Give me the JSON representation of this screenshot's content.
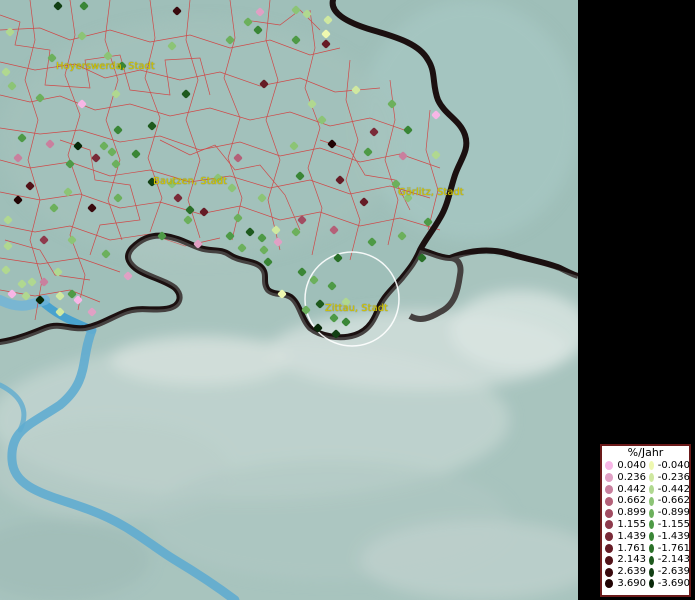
{
  "map": {
    "towns": [
      {
        "name": "Hoyerswerda, Stadt"
      },
      {
        "name": "Bautzen, Stadt"
      },
      {
        "name": "Görlitz, Stadt"
      },
      {
        "name": "Zittau, Stadt"
      }
    ],
    "colors": {
      "terrain": "#9fbfb9",
      "border": "#1b1010",
      "river": "#3f9fd0",
      "district_lines": "#d63535",
      "selection_circle": "#ffffff",
      "town_label": "#d8c800"
    }
  },
  "legend": {
    "title": "%/Jahr",
    "positive": [
      {
        "value": "0.040",
        "color": "#f7b6e6"
      },
      {
        "value": "0.236",
        "color": "#e0a0c4"
      },
      {
        "value": "0.442",
        "color": "#c9809e"
      },
      {
        "value": "0.662",
        "color": "#b46078"
      },
      {
        "value": "0.899",
        "color": "#a24c62"
      },
      {
        "value": "1.155",
        "color": "#8e3a4c"
      },
      {
        "value": "1.439",
        "color": "#7a2a38"
      },
      {
        "value": "1.761",
        "color": "#661c26"
      },
      {
        "value": "2.143",
        "color": "#521218"
      },
      {
        "value": "2.639",
        "color": "#3a0a0e"
      },
      {
        "value": "3.690",
        "color": "#220404"
      }
    ],
    "negative": [
      {
        "value": "-0.040",
        "color": "#eef8b0"
      },
      {
        "value": "-0.236",
        "color": "#cfe8a0"
      },
      {
        "value": "-0.442",
        "color": "#b0d890"
      },
      {
        "value": "-0.662",
        "color": "#8cc476"
      },
      {
        "value": "-0.899",
        "color": "#6cb05c"
      },
      {
        "value": "-1.155",
        "color": "#4e9a46"
      },
      {
        "value": "-1.439",
        "color": "#3a8636"
      },
      {
        "value": "-1.761",
        "color": "#2a7028"
      },
      {
        "value": "-2.143",
        "color": "#1e5a1e"
      },
      {
        "value": "-2.639",
        "color": "#124014"
      },
      {
        "value": "-3.690",
        "color": "#082808"
      }
    ]
  }
}
